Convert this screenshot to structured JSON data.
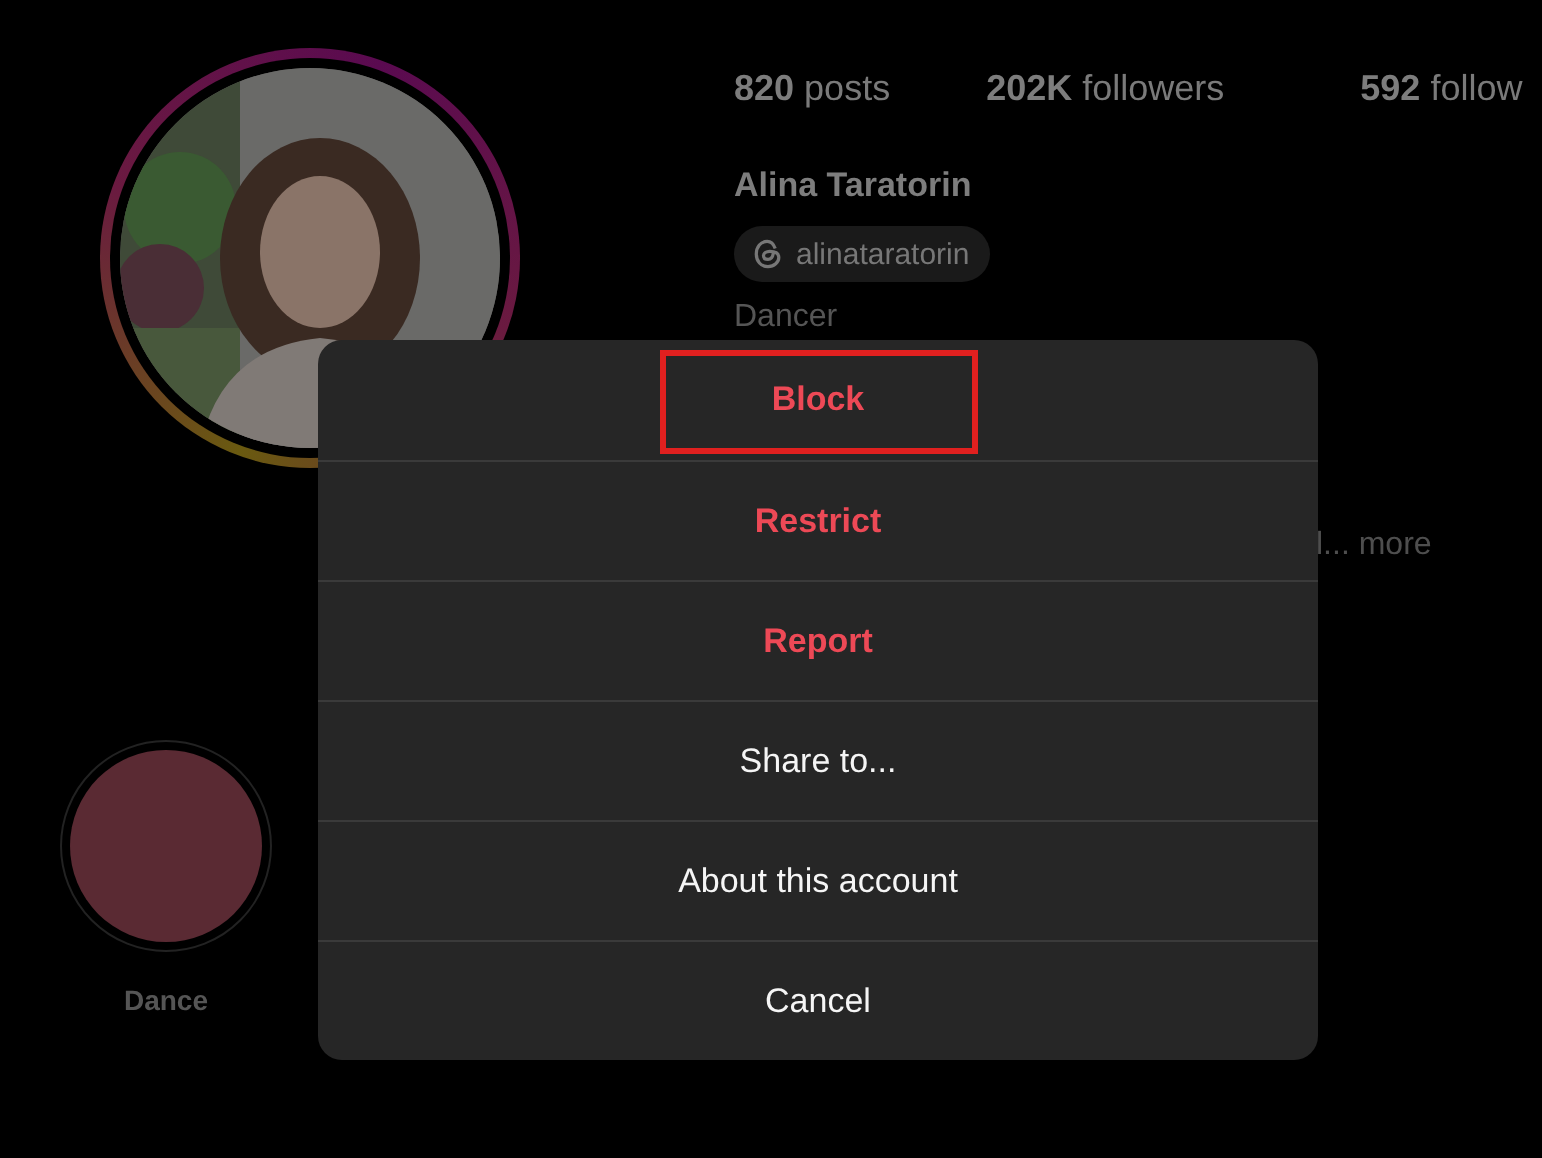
{
  "profile": {
    "stats": [
      {
        "count": "820",
        "label": "posts"
      },
      {
        "count": "202K",
        "label": "followers"
      },
      {
        "count": "592",
        "label": "follow"
      }
    ],
    "name": "Alina Taratorin",
    "threads_handle": "alinataratorin",
    "category": "Dancer",
    "bio_tail": "l... more",
    "highlights": [
      {
        "label": "Dance",
        "color": "#5a2a33"
      }
    ]
  },
  "menu": {
    "items": [
      {
        "label": "Block",
        "kind": "danger",
        "highlighted": true
      },
      {
        "label": "Restrict",
        "kind": "danger",
        "highlighted": false
      },
      {
        "label": "Report",
        "kind": "danger",
        "highlighted": false
      },
      {
        "label": "Share to...",
        "kind": "normal",
        "highlighted": false
      },
      {
        "label": "About this account",
        "kind": "normal",
        "highlighted": false
      },
      {
        "label": "Cancel",
        "kind": "normal",
        "highlighted": false
      }
    ]
  }
}
